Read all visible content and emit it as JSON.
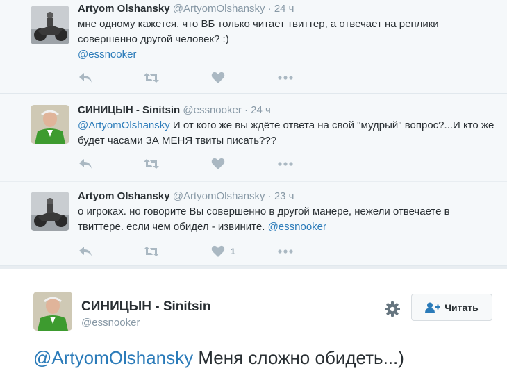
{
  "tweets": [
    {
      "name": "Artyom Olshansky",
      "handle": "@ArtyomOlshansky",
      "time": "24 ч",
      "text": "мне одному кажется, что ВБ только читает твиттер, а отвечает на реплики совершенно другой человек? :)",
      "mention": "@essnooker",
      "avatar": "motorcycle-photo"
    },
    {
      "name": "СИНИЦЫН - Sinitsin",
      "handle": "@essnooker",
      "time": "24 ч",
      "mention": "@ArtyomOlshansky",
      "text": " И от кого же вы ждёте ответа на свой \"мудрый\" вопрос?...И кто же будет часами ЗА МЕНЯ твиты писать???",
      "avatar": "man-green-jacket-photo"
    },
    {
      "name": "Artyom Olshansky",
      "handle": "@ArtyomOlshansky",
      "time": "23 ч",
      "text": "о игроках. но говорите Вы совершенно в другой манере, нежели отвечаете в твиттере. если чем обидел - извините.",
      "mention": "@essnooker",
      "like_count": "1",
      "avatar": "motorcycle-photo"
    }
  ],
  "main_tweet": {
    "name": "СИНИЦЫН - Sinitsin",
    "handle": "@essnooker",
    "mention": "@ArtyomOlshansky",
    "text": " Меня сложно обидеть...)",
    "follow_label": "Читать",
    "avatar": "man-green-jacket-photo"
  },
  "icons": {
    "reply": "reply-icon",
    "retweet": "retweet-icon",
    "like": "heart-icon",
    "more": "more-icon",
    "settings": "gear-icon",
    "follow": "follow-person-icon"
  },
  "colors": {
    "link": "#2b7bb9",
    "muted": "#8899a6",
    "icon": "#aab8c2"
  }
}
